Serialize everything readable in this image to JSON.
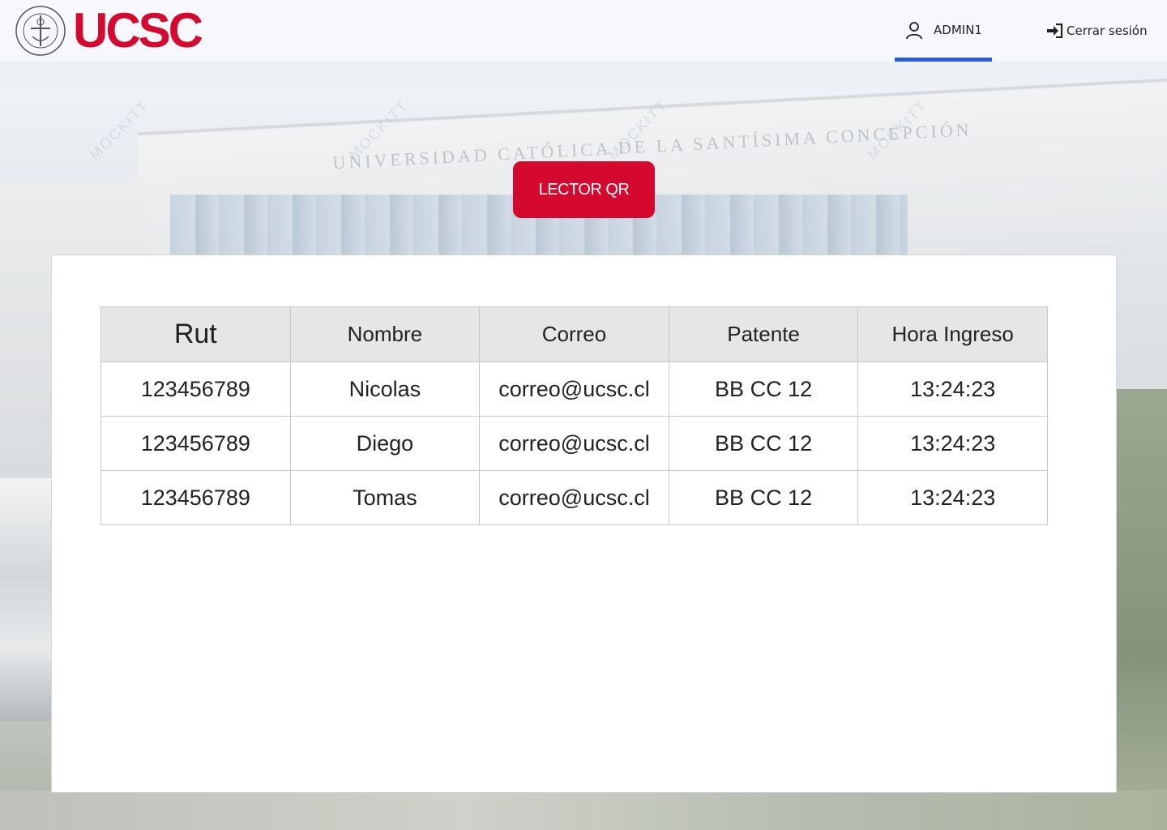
{
  "brand": {
    "name": "UCSC",
    "seal_text": "UNIVERSIDAD CATÓLICA DE LA SANTÍSIMA CONCEPCIÓN",
    "color": "#d5092f"
  },
  "header": {
    "user": {
      "icon": "user-icon",
      "label": "ADMIN1"
    },
    "logout": {
      "icon": "sign-in-icon",
      "label": "Cerrar sesión"
    },
    "active_tab_color": "#2d5be3"
  },
  "background": {
    "building_sign": "UNIVERSIDAD CATÓLICA DE LA SANTÍSIMA CONCEPCIÓN",
    "watermark": "MOCKITT"
  },
  "qr_button": {
    "label": "LECTOR QR",
    "color": "#d5092f"
  },
  "table": {
    "columns": [
      "Rut",
      "Nombre",
      "Correo",
      "Patente",
      "Hora Ingreso"
    ],
    "rows": [
      {
        "rut": "123456789",
        "nombre": "Nicolas",
        "correo": "correo@ucsc.cl",
        "patente": "BB CC 12",
        "hora": "13:24:23"
      },
      {
        "rut": "123456789",
        "nombre": "Diego",
        "correo": "correo@ucsc.cl",
        "patente": "BB CC 12",
        "hora": "13:24:23"
      },
      {
        "rut": "123456789",
        "nombre": "Tomas",
        "correo": "correo@ucsc.cl",
        "patente": "BB CC 12",
        "hora": "13:24:23"
      }
    ]
  }
}
